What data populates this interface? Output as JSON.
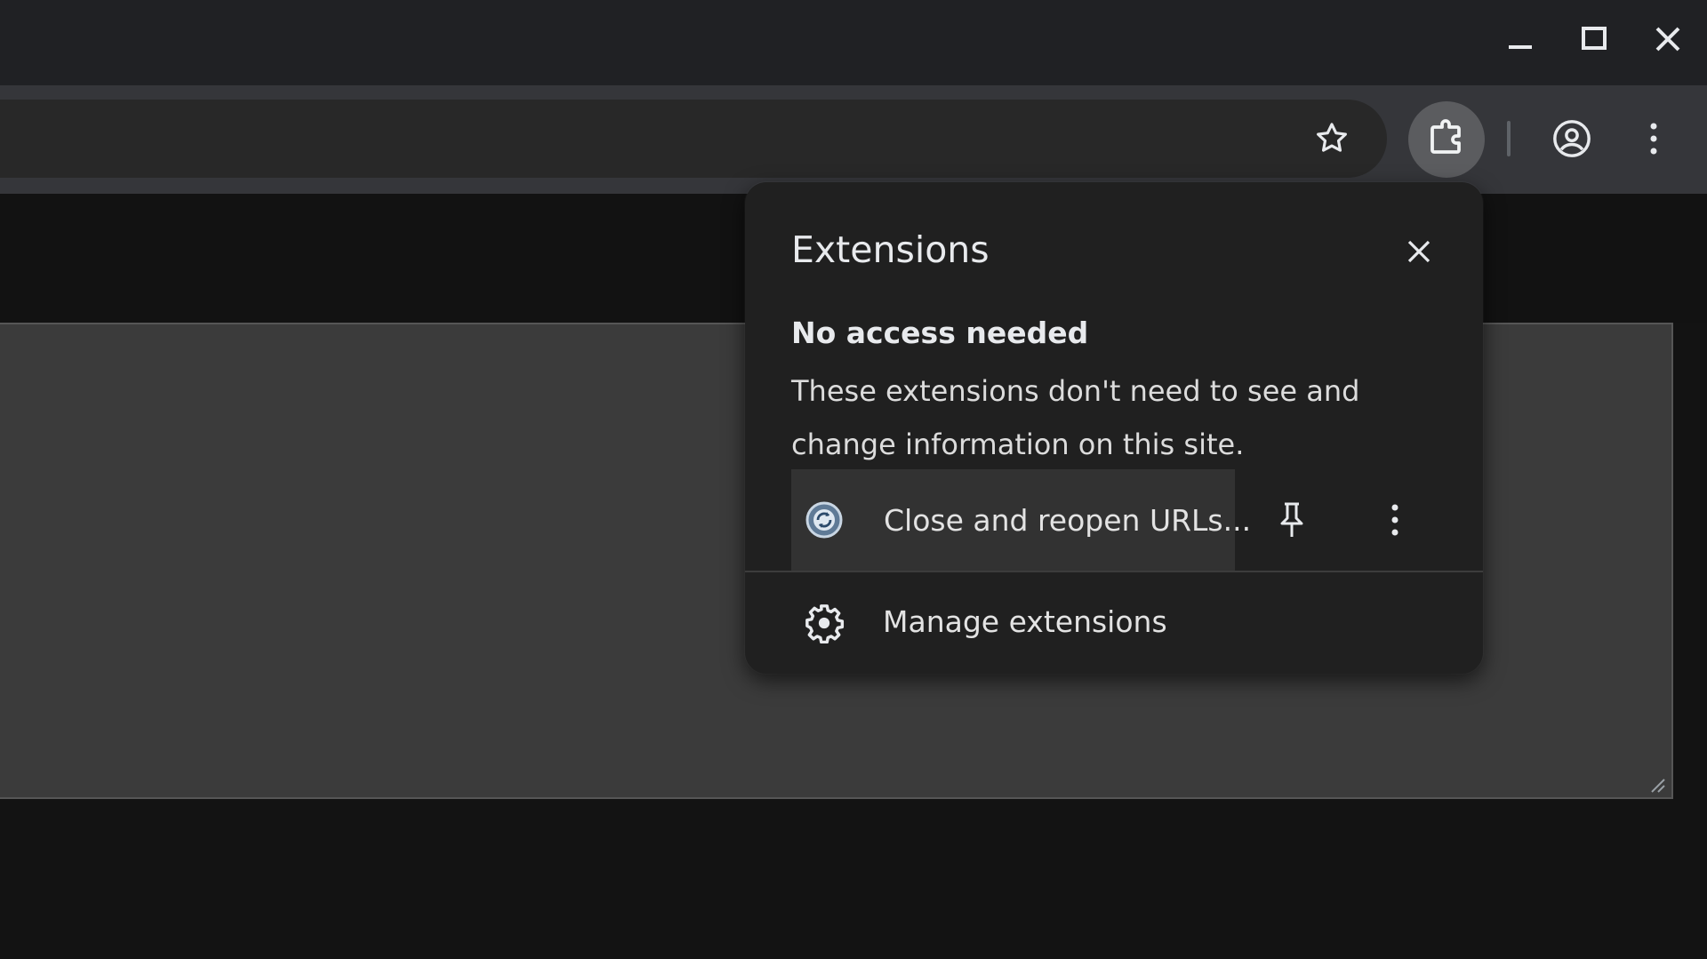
{
  "popup": {
    "title": "Extensions",
    "section_title": "No access needed",
    "section_description": "These extensions don't need to see and change information on this site.",
    "extension": {
      "name": "Close and reopen URLs...",
      "icon": "refresh-globe-icon"
    },
    "manage_label": "Manage extensions"
  },
  "icons": {
    "window": [
      "minimize-icon",
      "maximize-icon",
      "close-window-icon"
    ],
    "toolbar": [
      "bookmark-star-icon",
      "extensions-puzzle-icon",
      "profile-icon",
      "more-vert-icon"
    ],
    "popup": [
      "close-icon",
      "pin-icon",
      "more-vert-icon",
      "gear-icon"
    ]
  },
  "colors": {
    "titlebar": "#202124",
    "toolbar": "#35363a",
    "popup_bg": "#202020",
    "extension_row_highlight": "#323232",
    "content_panel": "#3b3b3b"
  }
}
